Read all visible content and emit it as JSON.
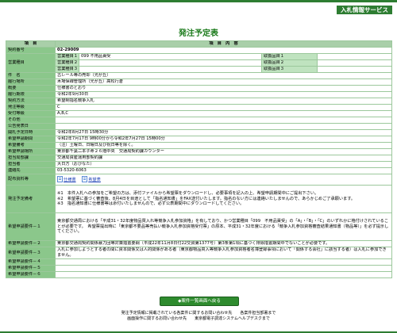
{
  "header": {
    "service_label": "入札情報サービス"
  },
  "page_title": "発注予定表",
  "table": {
    "col_item": "項　目",
    "col_content": "項　目　内　容",
    "contract_no_label": "契約番号",
    "contract_no": "02-29009",
    "business_type_label": "営業種目",
    "business_rows": [
      {
        "label": "営業種目１",
        "value": "099 不用品賣受",
        "right": "取扱品目１"
      },
      {
        "label": "営業種目２",
        "value": "",
        "right": "取扱品目２"
      },
      {
        "label": "営業種目３",
        "value": "",
        "right": "取扱品目３"
      }
    ],
    "subject_label": "件　名",
    "subject": "古レール等の売却（光が丘）",
    "place_label": "履行場所",
    "place": "木場保線管理所（光が丘）高松行倉",
    "summary_label": "概要",
    "summary": "仕様書のとおり",
    "period_label": "履行期限",
    "period": "令和2年9月30日",
    "method_label": "契約方法",
    "method": "希望制指名競争入札",
    "order_grade_label": "発注等級",
    "order_grade": "C",
    "accept_grade_label": "受付等級",
    "accept_grade": "A,B,C",
    "other_label": "その他",
    "other": "",
    "publish_date_label": "公告発表日",
    "publish_date": "",
    "open_date_label": "開札予定日時",
    "open_date": "令和2年8月27日 15時30分",
    "apply_period_label": "希望申請期間",
    "apply_period": "令和2年7月17日 9時00分から令和2年7月27日 15時00分",
    "apply_remark_label": "希望備考",
    "apply_remark": "（注）土曜日、日曜日及び祝日等を除く。",
    "apply_window_label": "希望申請場所",
    "apply_window": "東京都千葉二本子命２６階中央　交通局契約課カウンター",
    "dept_label": "担当局部課",
    "dept": "交通局資産運用部契約課",
    "person_label": "担当者",
    "person": "大日方（おびなた）",
    "contact_label": "連絡先",
    "contact": "03-5320-6063",
    "docs_label": "配布資料等",
    "doc_links": [
      "仕様書",
      "希望表"
    ],
    "schedule_label": "発注予定備考",
    "schedule_notes": [
      "※1　本件入札への参加をご希望の方は、添付ファイルから希望票をダウンロードし、必要事項を記入の上、希望申請期間中にご提出下さい。",
      "※2　希望票に基づく審査後、8月4日を目途として「指名通知書」をFAX送付いたします。指名のない方には連絡いたしませんので、あらかじめご了承願います。",
      "※3　指名通知書に仕様書等は添付いたしませんので、必ず公表期間中にダウンロードしてください。"
    ],
    "req1_label": "希望申請要件－１",
    "req1": "東京都交通局における「平成31・32年度物品買入れ等競争入札参加資格」を有しており、かつ営業種目「099　不用品賣受」の「A」・「B」・「C」のいずれかに格付けされていることが必要です。　希望票提出時に「東京都不要品等売払い競争入札参加資格受付票」の原本、平成31・32年度における「競争入札参加資格審査結果通知書（物品等）」を必ず提示してください。",
    "req2_label": "希望申請要件－２",
    "req2": "東京都交通局契約関係暴力団等対策措置要綱（平成22年11月8日付22交資第1377号）第3条第1項に基づく排除措置期間中でないことが必要です。",
    "req3_label": "希望申請要件－３",
    "req3": "入札に参加しようとする者の間に資本関係又は人的関係がある者（東京都物品買入等競争入札参加資格者名簿登録事項において「関係する会社」に該当する者）は入札に参加できません。",
    "req4_label": "希望申請要件－４",
    "req4": "",
    "req5_label": "希望申請要件－５",
    "req5": "",
    "req6_label": "希望申請要件－６",
    "req6": ""
  },
  "return_button": "◆案件一覧画面へ戻る",
  "footer": {
    "line1": "発注予定情報に掲載されている各案件に関するお問い合わせ先　　各案件担当部署まで",
    "line2": "画面操作に関するお問い合わせ先　　東京都電子調達システムヘルプデスクまで"
  },
  "colors": {
    "brand_green": "#2e7d32",
    "label_green": "#8bc78b",
    "link_blue": "#1a3fb5"
  }
}
